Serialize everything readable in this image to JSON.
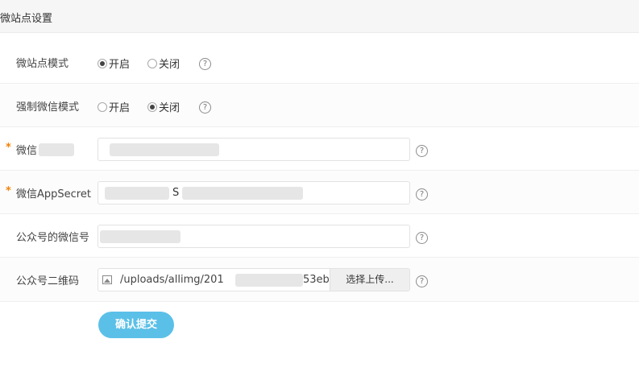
{
  "header": {
    "title": "微站点设置"
  },
  "rows": {
    "site_mode": {
      "label": "微站点模式",
      "options": [
        {
          "label": "开启",
          "checked": true
        },
        {
          "label": "关闭",
          "checked": false
        }
      ],
      "help": "?"
    },
    "force_wechat": {
      "label": "强制微信模式",
      "options": [
        {
          "label": "开启",
          "checked": false
        },
        {
          "label": "关闭",
          "checked": true
        }
      ],
      "help": "?"
    },
    "appid": {
      "required_mark": "*",
      "label": "微信",
      "value": "",
      "help": "?"
    },
    "appsecret": {
      "required_mark": "*",
      "label": "微信AppSecret",
      "value_tail": "S",
      "help": "?"
    },
    "wechat_id": {
      "label": "公众号的微信号",
      "value": "",
      "help": "?"
    },
    "qrcode": {
      "label": "公众号二维码",
      "file_value": "/uploads/allimg/201",
      "file_value_tail": "53eb",
      "upload_button": "选择上传...",
      "help": "?"
    }
  },
  "submit_button": "确认提交",
  "colors": {
    "accent": "#5bc0e8",
    "required": "#f0830a",
    "header_bg": "#f6f6f6"
  }
}
